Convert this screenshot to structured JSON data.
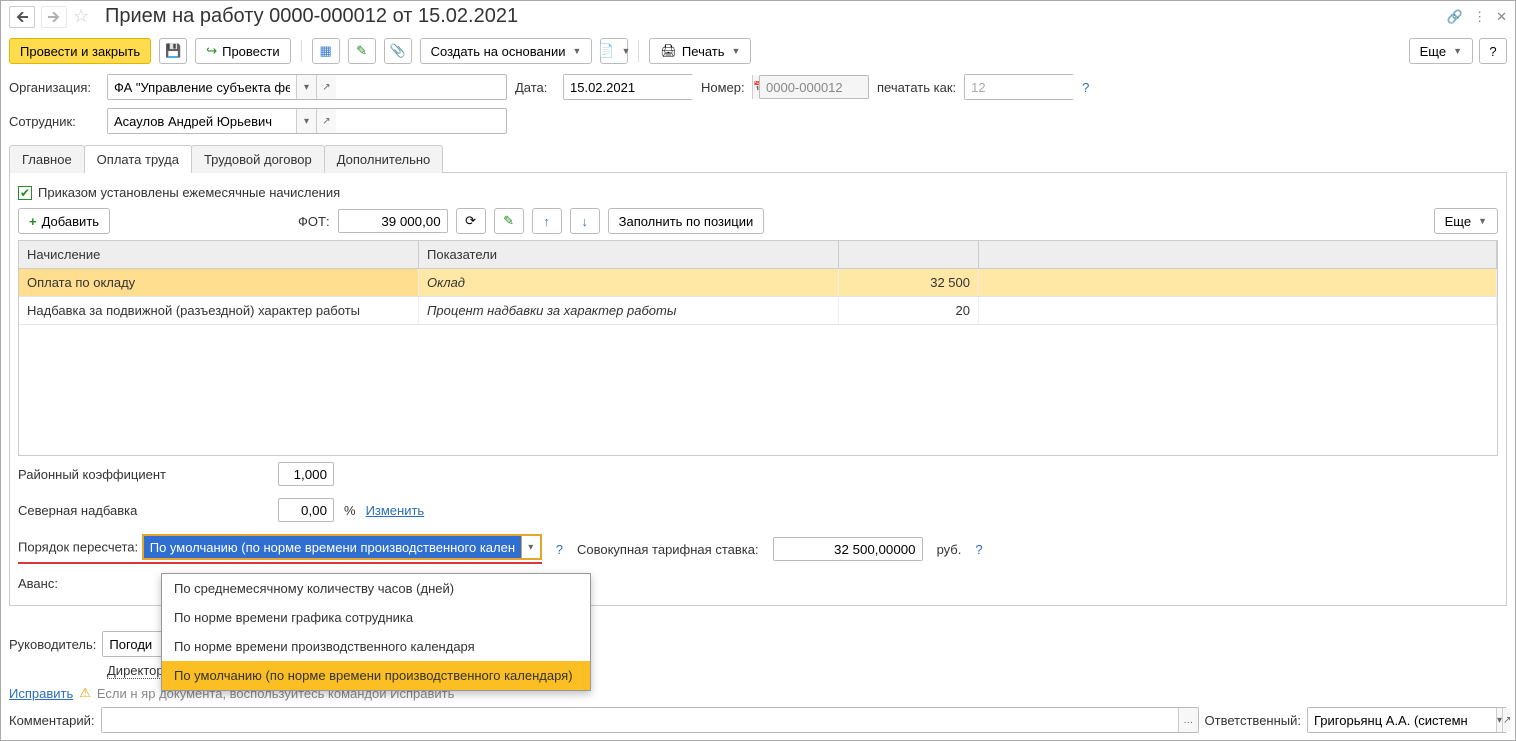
{
  "title": "Прием на работу 0000-000012 от 15.02.2021",
  "toolbar": {
    "post_close": "Провести и закрыть",
    "post": "Провести",
    "create_based": "Создать на основании",
    "print": "Печать",
    "more": "Еще",
    "help": "?"
  },
  "header": {
    "org_label": "Организация:",
    "org_value": "ФА \"Управление субъекта федерации\"",
    "date_label": "Дата:",
    "date_value": "15.02.2021",
    "number_label": "Номер:",
    "number_value": "0000-000012",
    "print_as_label": "печатать как:",
    "print_as_value": "12",
    "employee_label": "Сотрудник:",
    "employee_value": "Асаулов Андрей Юрьевич"
  },
  "tabs": {
    "main": "Главное",
    "pay": "Оплата труда",
    "contract": "Трудовой договор",
    "extra": "Дополнительно"
  },
  "pay_tab": {
    "checkbox_label": "Приказом установлены ежемесячные начисления",
    "add_btn": "Добавить",
    "fot_label": "ФОТ:",
    "fot_value": "39 000,00",
    "fill_btn": "Заполнить по позиции",
    "more": "Еще",
    "table": {
      "col_nach": "Начисление",
      "col_pokaz": "Показатели",
      "rows": [
        {
          "nach": "Оплата по окладу",
          "pokaz": "Оклад",
          "val": "32 500"
        },
        {
          "nach": "Надбавка за подвижной (разъездной) характер работы",
          "pokaz": "Процент надбавки за характер работы",
          "val": "20"
        }
      ]
    },
    "rayk_label": "Районный коэффициент",
    "rayk_value": "1,000",
    "sev_label": "Северная надбавка",
    "sev_value": "0,00",
    "sev_pct": "%",
    "change_link": "Изменить",
    "recalc_label": "Порядок пересчета:",
    "recalc_value": "По умолчанию (по норме времени производственного календаря)",
    "recalc_options": [
      "По среднемесячному количеству часов (дней)",
      "По норме времени графика сотрудника",
      "По норме времени производственного календаря",
      "По умолчанию (по норме времени производственного календаря)"
    ],
    "tariff_label": "Совокупная тарифная ставка:",
    "tariff_value": "32 500,00000",
    "tariff_unit": "руб.",
    "advance_label": "Аванс:"
  },
  "boss": {
    "label": "Руководитель:",
    "value": "Погоди",
    "position": "Директор"
  },
  "fix_link": "Исправить",
  "warn_text": "Если необходимо зарегистрировать изменение сведений о сотруднике, не изменяя первоначальных сведений — создать документ, воспользуйтесь командой Исправить",
  "warn_text_visible": "Если н                                                                                                                                   яр документа, воспользуйтесь командой Исправить",
  "comment_label": "Комментарий:",
  "responsible_label": "Ответственный:",
  "responsible_value": "Григорьянц А.А. (системн"
}
